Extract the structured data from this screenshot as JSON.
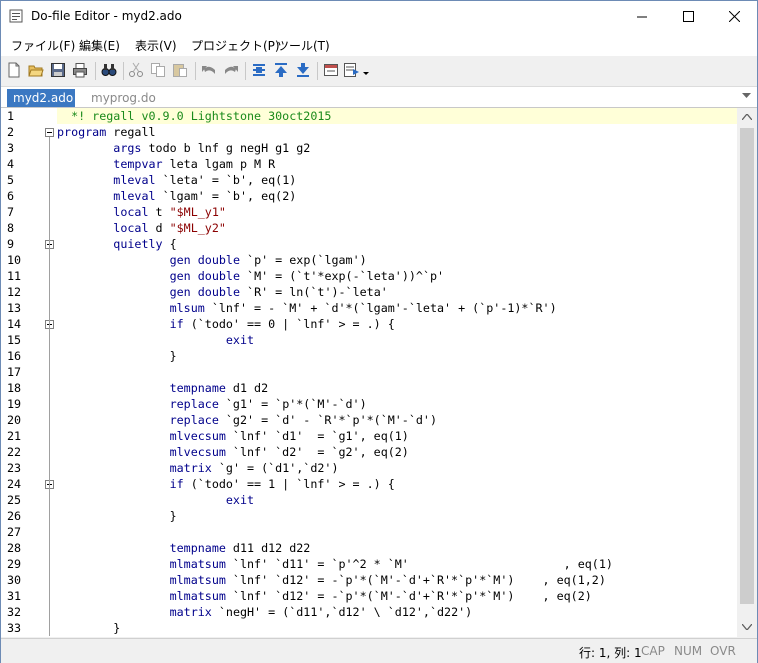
{
  "window": {
    "title": "Do-file Editor - myd2.ado",
    "controls": {
      "minimize": "—",
      "maximize": "☐",
      "close": "✕"
    }
  },
  "menu": [
    "ファイル(F)",
    "編集(E)",
    "表示(V)",
    "プロジェクト(P)",
    "ツール(T)"
  ],
  "toolbar": [
    "new-file-icon",
    "open-folder-icon",
    "save-icon",
    "print-icon",
    "find-icon",
    "cut-icon",
    "copy-icon",
    "paste-icon",
    "undo-icon",
    "redo-icon",
    "toggle-bookmark-icon",
    "previous-bookmark-icon",
    "next-bookmark-icon",
    "show-file-in-viewer-icon",
    "execute-do-icon"
  ],
  "tabs": [
    {
      "label": "myd2.ado",
      "active": true
    },
    {
      "label": "myprog.do",
      "active": false
    }
  ],
  "editor": {
    "lines": [
      {
        "n": "1",
        "text": "  *! regall v0.9.0 Lightstone 30oct2015"
      },
      {
        "n": "2",
        "text": "program regall"
      },
      {
        "n": "3",
        "text": "        args todo b lnf g negH g1 g2"
      },
      {
        "n": "4",
        "text": "        tempvar leta lgam p M R"
      },
      {
        "n": "5",
        "text": "        mleval `leta' = `b', eq(1)"
      },
      {
        "n": "6",
        "text": "        mleval `lgam' = `b', eq(2)"
      },
      {
        "n": "7",
        "text": "        local t \"$ML_y1\""
      },
      {
        "n": "8",
        "text": "        local d \"$ML_y2\""
      },
      {
        "n": "9",
        "text": "        quietly {"
      },
      {
        "n": "10",
        "text": "                gen double `p' = exp(`lgam')"
      },
      {
        "n": "11",
        "text": "                gen double `M' = (`t'*exp(-`leta'))^`p'"
      },
      {
        "n": "12",
        "text": "                gen double `R' = ln(`t')-`leta'"
      },
      {
        "n": "13",
        "text": "                mlsum `lnf' = - `M' + `d'*(`lgam'-`leta' + (`p'-1)*`R')"
      },
      {
        "n": "14",
        "text": "                if (`todo' == 0 | `lnf' > = .) {"
      },
      {
        "n": "15",
        "text": "                        exit"
      },
      {
        "n": "16",
        "text": "                }"
      },
      {
        "n": "17",
        "text": ""
      },
      {
        "n": "18",
        "text": "                tempname d1 d2"
      },
      {
        "n": "19",
        "text": "                replace `g1' = `p'*(`M'-`d')"
      },
      {
        "n": "20",
        "text": "                replace `g2' = `d' - `R'*`p'*(`M'-`d')"
      },
      {
        "n": "21",
        "text": "                mlvecsum `lnf' `d1'  = `g1', eq(1)"
      },
      {
        "n": "22",
        "text": "                mlvecsum `lnf' `d2'  = `g2', eq(2)"
      },
      {
        "n": "23",
        "text": "                matrix `g' = (`d1',`d2')"
      },
      {
        "n": "24",
        "text": "                if (`todo' == 1 | `lnf' > = .) {"
      },
      {
        "n": "25",
        "text": "                        exit"
      },
      {
        "n": "26",
        "text": "                }"
      },
      {
        "n": "27",
        "text": ""
      },
      {
        "n": "28",
        "text": "                tempname d11 d12 d22"
      },
      {
        "n": "29",
        "text": "                mlmatsum `lnf' `d11' = `p'^2 * `M'                      , eq(1)"
      },
      {
        "n": "30",
        "text": "                mlmatsum `lnf' `d12' = -`p'*(`M'-`d'+`R'*`p'*`M')    , eq(1,2)"
      },
      {
        "n": "31",
        "text": "                mlmatsum `lnf' `d12' = -`p'*(`M'-`d'+`R'*`p'*`M')    , eq(2)"
      },
      {
        "n": "32",
        "text": "                matrix `negH' = (`d11',`d12' \\ `d12',`d22')"
      },
      {
        "n": "33",
        "text": "        }"
      }
    ]
  },
  "status": {
    "position": "行: 1, 列: 1",
    "cap": "CAP",
    "num": "NUM",
    "ovr": "OVR"
  },
  "colors": {
    "accent": "#3b78c2",
    "comment": "#1a8a1a",
    "keyword": "#00008b",
    "string": "#8b0000",
    "current_line": "#ffffd8"
  }
}
